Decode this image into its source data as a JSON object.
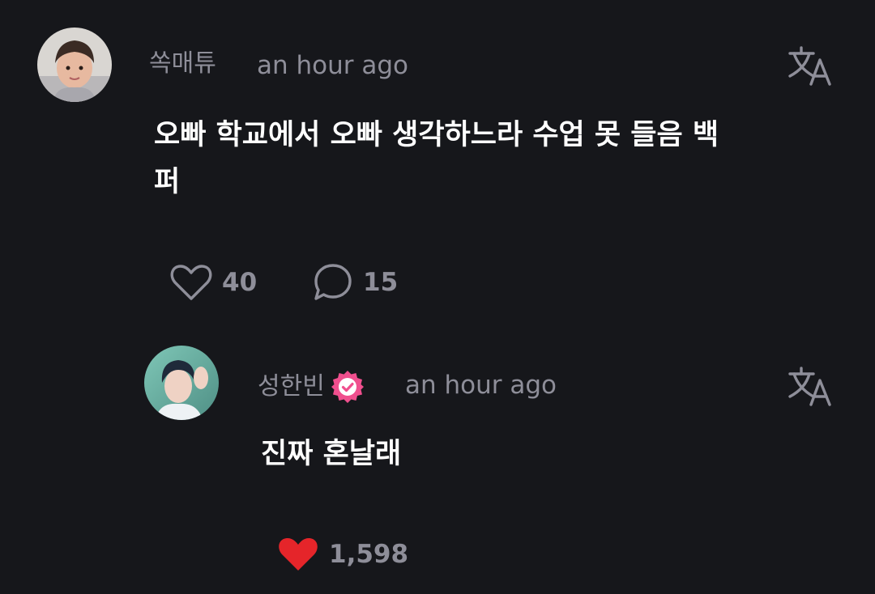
{
  "comment": {
    "username": "쏙매튜",
    "time": "an hour ago",
    "text": "오빠 학교에서 오빠 생각하느라 수업 못 들음 백퍼",
    "likes": "40",
    "replies": "15"
  },
  "reply": {
    "username": "성한빈",
    "time": "an hour ago",
    "text": "진짜 혼날래",
    "likes": "1,598"
  },
  "colors": {
    "background": "#16171b",
    "muted": "#8e8e99",
    "text": "#ffffff",
    "badge": "#f04f8e",
    "liked_heart": "#e5252a"
  },
  "icons": {
    "translate": "translate-icon",
    "like": "heart-icon",
    "liked": "heart-filled-icon",
    "reply": "comment-bubble-icon",
    "verified": "verified-badge-icon"
  }
}
